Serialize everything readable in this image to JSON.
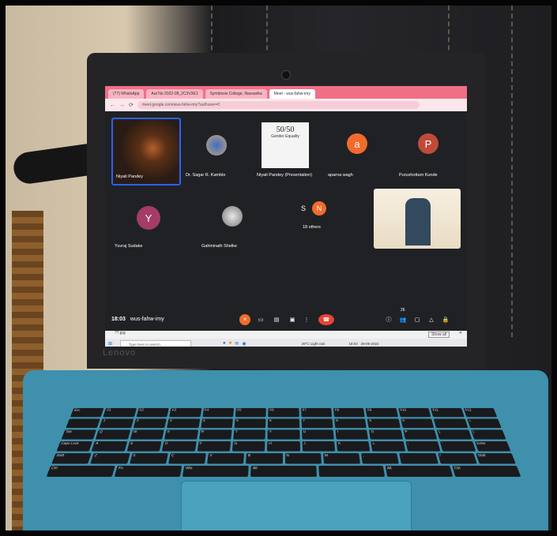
{
  "browser": {
    "tabs": [
      "(77) WhatsApp",
      "Aut No 2022-08_2C3V3E1",
      "Symbiosis College, Navsarika",
      "Meet - wus-fahw-imy"
    ],
    "address": "meet.google.com/wus-fahw-imy?authuser=0"
  },
  "meet": {
    "participants": [
      {
        "name": "Niyati Pandey",
        "type": "video"
      },
      {
        "name": "Dr. Sagar R. Kamble",
        "type": "avatar",
        "initial": ""
      },
      {
        "name": "Niyati Pandey (Presentation)",
        "type": "slide",
        "slide_title": "Gender Equality",
        "slide_logo": "50/50"
      },
      {
        "name": "aparna wagh",
        "type": "avatar",
        "initial": "a"
      },
      {
        "name": "Purushottam Kunde",
        "type": "avatar",
        "initial": "P"
      },
      {
        "name": "Yuvraj Sudake",
        "type": "avatar",
        "initial": "Y"
      },
      {
        "name": "Gahininath Shelke",
        "type": "avatar",
        "initial": ""
      },
      {
        "name": "18 others",
        "type": "group",
        "initials": [
          "S",
          "N"
        ]
      },
      {
        "name": "",
        "type": "video"
      }
    ],
    "time": "18:03",
    "meeting_code": "wus-fahw-imy",
    "people_count": "26"
  },
  "downloads": {
    "file": "??.jpg",
    "show_all": "Show all"
  },
  "taskbar": {
    "search_placeholder": "Type here to search",
    "weather": "29°C Light rain",
    "clock_time": "18:03",
    "clock_date": "28-06-2022"
  },
  "laptop": {
    "brand": "Lenovo"
  },
  "keyboard": {
    "rows": [
      [
        "Esc",
        "F1",
        "F2",
        "F3",
        "F4",
        "F5",
        "F6",
        "F7",
        "F8",
        "F9",
        "F10",
        "F11",
        "F12"
      ],
      [
        "`",
        "1",
        "2",
        "3",
        "4",
        "5",
        "6",
        "7",
        "8",
        "9",
        "0",
        "-",
        "="
      ],
      [
        "Tab",
        "Q",
        "W",
        "E",
        "R",
        "T",
        "Y",
        "U",
        "I",
        "O",
        "P",
        "[",
        "]"
      ],
      [
        "Caps Lock",
        "A",
        "S",
        "D",
        "F",
        "G",
        "H",
        "J",
        "K",
        "L",
        ";",
        "'",
        "Enter"
      ],
      [
        "Shift",
        "Z",
        "X",
        "C",
        "V",
        "B",
        "N",
        "M",
        ",",
        ".",
        "/",
        "Shift"
      ],
      [
        "Ctrl",
        "Fn",
        "Win",
        "Alt",
        "",
        "Alt",
        "Ctrl"
      ]
    ]
  },
  "colors": {
    "meet_bg": "#202124",
    "tile_bg": "#3c4043",
    "end_call": "#ea4335",
    "orange": "#f26b2c",
    "tab_strip": "#f06e86",
    "laptop_base": "#3e90ad"
  }
}
